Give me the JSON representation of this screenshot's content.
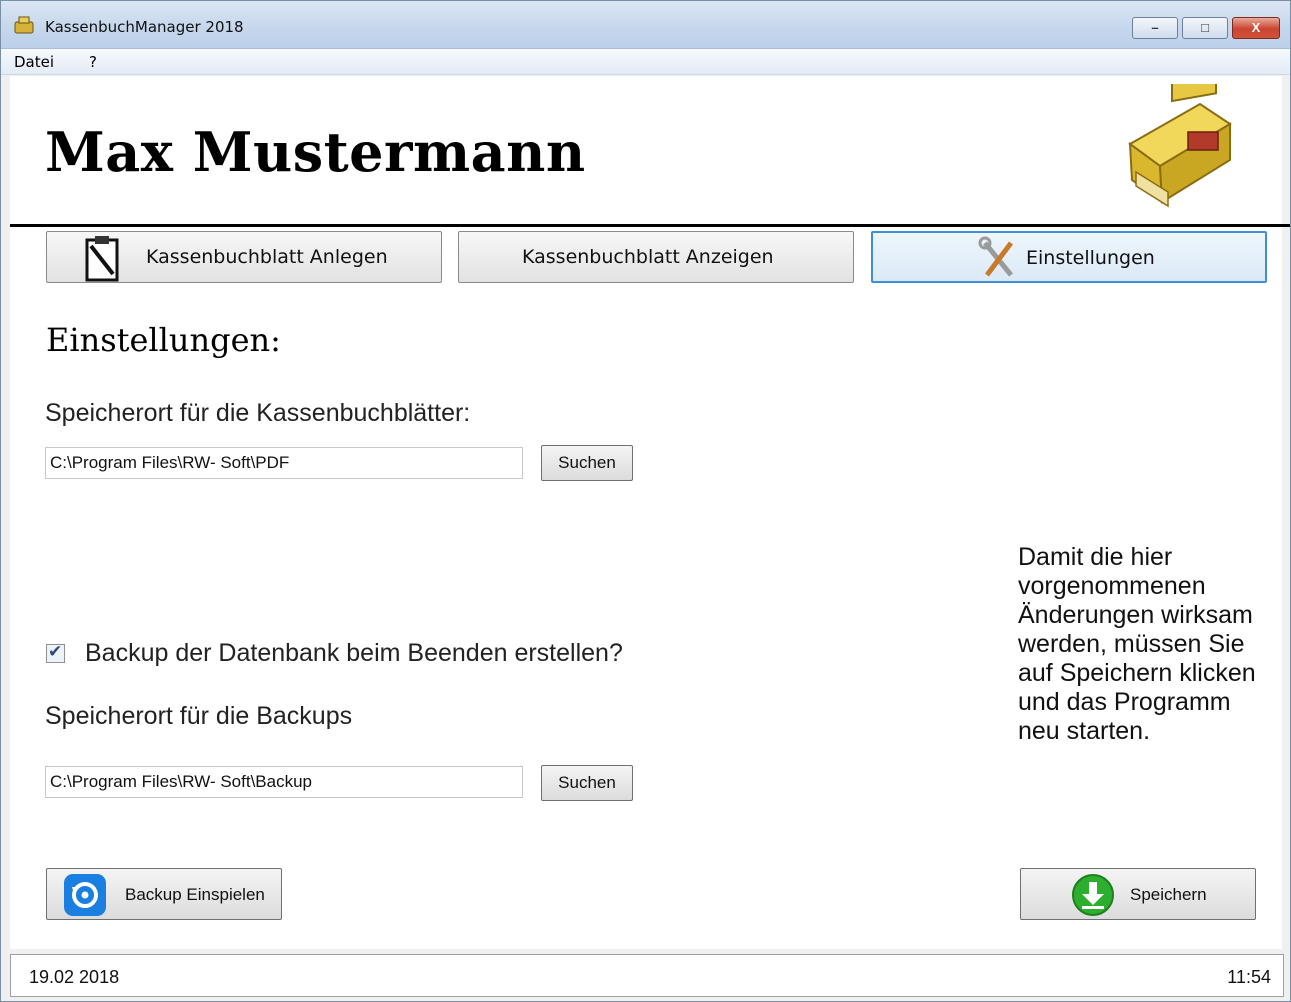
{
  "window": {
    "title": "KassenbuchManager 2018",
    "controls": {
      "minimize": "–",
      "maximize": "□",
      "close": "X"
    }
  },
  "menu": {
    "items": [
      {
        "label": "Datei"
      },
      {
        "label": "?"
      }
    ]
  },
  "header": {
    "name": "Max Mustermann",
    "image": "cash-register-icon"
  },
  "nav": {
    "create_label": "Kassenbuchblatt Anlegen",
    "show_label": "Kassenbuchblatt Anzeigen",
    "settings_label": "Einstellungen",
    "active": "Einstellungen"
  },
  "settings": {
    "title": "Einstellungen:",
    "storage_label": "Speicherort für die Kassenbuchblätter:",
    "storage_path": "C:\\Program Files\\RW- Soft\\PDF",
    "storage_search": "Suchen",
    "backup_checkbox_label": "Backup der Datenbank beim Beenden erstellen?",
    "backup_checked": true,
    "backup_label": "Speicherort für die Backups",
    "backup_path": "C:\\Program Files\\RW- Soft\\Backup",
    "backup_search": "Suchen",
    "hint": "Damit die hier vorgenommenen Änderungen wirksam werden, müssen Sie auf Speichern klicken und das Programm neu starten.",
    "restore_button": "Backup Einspielen",
    "save_button": "Speichern"
  },
  "status": {
    "date": "19.02 2018",
    "time": "11:54"
  },
  "colors": {
    "accent": "#3d8fd6",
    "restore_icon": "#1a7fe0",
    "save_icon": "#2eae2e",
    "register_gold": "#e2c233"
  }
}
